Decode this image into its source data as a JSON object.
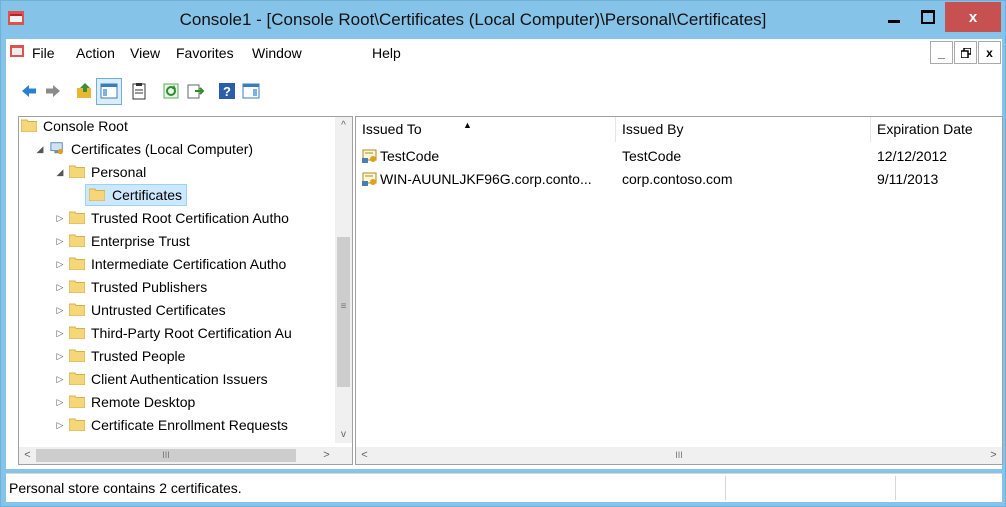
{
  "window": {
    "title": "Console1 - [Console Root\\Certificates (Local Computer)\\Personal\\Certificates]",
    "minimize_glyph": "",
    "maximize_glyph": "",
    "close_glyph": "x"
  },
  "menu": {
    "items": [
      {
        "label": "File"
      },
      {
        "label": "Action"
      },
      {
        "label": "View"
      },
      {
        "label": "Favorites"
      },
      {
        "label": "Window"
      },
      {
        "label": "Help"
      }
    ],
    "child_min": "_",
    "child_restore": "🗗",
    "child_close": "x"
  },
  "toolbar": {
    "icons": [
      "back-arrow-icon",
      "forward-arrow-icon",
      "up-folder-icon",
      "show-hide-tree-icon",
      "properties-icon",
      "refresh-icon",
      "export-list-icon",
      "help-icon",
      "show-hide-action-pane-icon"
    ]
  },
  "tree": {
    "items": [
      {
        "label": "Console Root",
        "level": 0,
        "expander": ""
      },
      {
        "label": "Certificates (Local Computer)",
        "level": 1,
        "expander": "◢"
      },
      {
        "label": "Personal",
        "level": 2,
        "expander": "◢"
      },
      {
        "label": "Certificates",
        "level": 3,
        "expander": "",
        "selected": true
      },
      {
        "label": "Trusted Root Certification Autho",
        "level": 2,
        "expander": "▷"
      },
      {
        "label": "Enterprise Trust",
        "level": 2,
        "expander": "▷"
      },
      {
        "label": "Intermediate Certification Autho",
        "level": 2,
        "expander": "▷"
      },
      {
        "label": "Trusted Publishers",
        "level": 2,
        "expander": "▷"
      },
      {
        "label": "Untrusted Certificates",
        "level": 2,
        "expander": "▷"
      },
      {
        "label": "Third-Party Root Certification Au",
        "level": 2,
        "expander": "▷"
      },
      {
        "label": "Trusted People",
        "level": 2,
        "expander": "▷"
      },
      {
        "label": "Client Authentication Issuers",
        "level": 2,
        "expander": "▷"
      },
      {
        "label": "Remote Desktop",
        "level": 2,
        "expander": "▷"
      },
      {
        "label": "Certificate Enrollment Requests",
        "level": 2,
        "expander": "▷"
      }
    ]
  },
  "list": {
    "columns": [
      "Issued To",
      "Issued By",
      "Expiration Date"
    ],
    "rows": [
      {
        "issued_to": "TestCode",
        "issued_by": "TestCode",
        "expiration": "12/12/2012"
      },
      {
        "issued_to": "WIN-AUUNLJKF96G.corp.conto...",
        "issued_by": "corp.contoso.com",
        "expiration": "9/11/2013"
      }
    ]
  },
  "scroll": {
    "up": "^",
    "down": "v",
    "left": "<",
    "right": ">",
    "grip": "≡",
    "hgrip": "III"
  },
  "status": {
    "text": "Personal store contains 2 certificates."
  },
  "colors": {
    "titlebar": "#86c3e8",
    "close_button": "#c75050",
    "selection": "#cce8ff",
    "folder": "#f5d77a"
  }
}
